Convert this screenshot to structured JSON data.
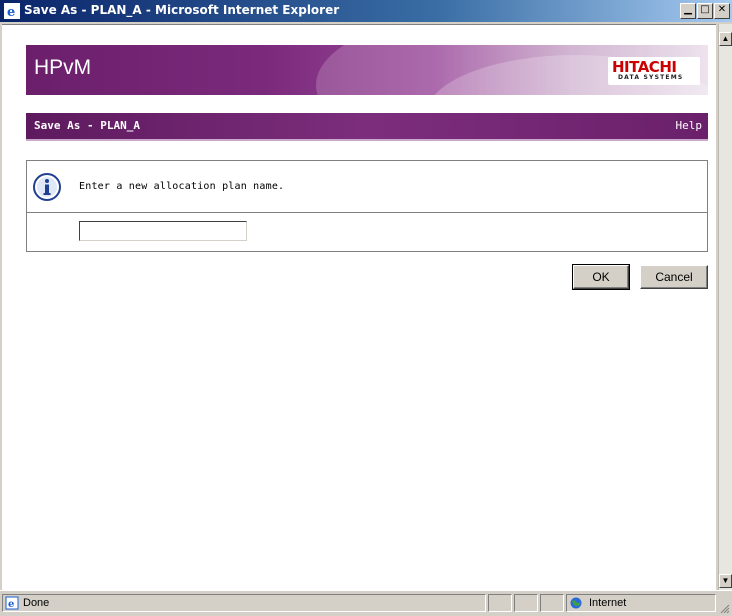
{
  "window": {
    "title": "Save As - PLAN_A - Microsoft Internet Explorer",
    "buttons": [
      "minimize",
      "maximize",
      "close"
    ]
  },
  "banner": {
    "app_title": "HPvM",
    "logo_brand": "HITACHI",
    "logo_sub": "DATA SYSTEMS"
  },
  "header": {
    "title": "Save As - PLAN_A",
    "help_label": "Help"
  },
  "dialog": {
    "message": "Enter a new allocation plan name.",
    "input_value": "",
    "ok_label": "OK",
    "cancel_label": "Cancel"
  },
  "statusbar": {
    "status_text": "Done",
    "zone_text": "Internet"
  },
  "colors": {
    "titlebar": "#0a246a",
    "banner_purple": "#6b1f6b",
    "header_purple": "#5e1a5e",
    "logo_red": "#cc0000",
    "chrome": "#d4d0c8"
  }
}
